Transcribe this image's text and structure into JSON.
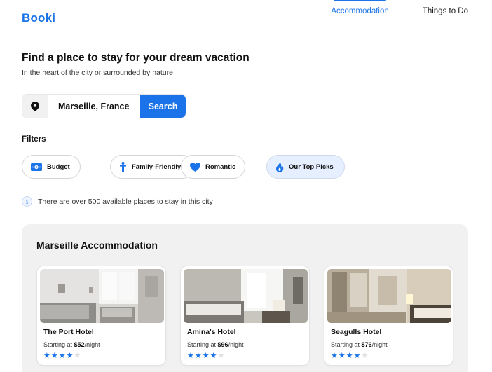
{
  "brand": {
    "logo": "Booki"
  },
  "nav": [
    {
      "label": "Accommodation",
      "active": true
    },
    {
      "label": "Things to Do",
      "active": false
    }
  ],
  "hero": {
    "title": "Find a place to stay for your dream vacation",
    "subtitle": "In the heart of the city or surrounded by nature"
  },
  "search": {
    "value": "Marseille, France",
    "placeholder": "Marseille, France",
    "button_label": "Search",
    "icon": "location-pin-icon"
  },
  "filters": {
    "title": "Filters",
    "items": [
      {
        "label": "Budget",
        "icon": "money-icon",
        "selected": false
      },
      {
        "label": "Family-Friendly",
        "icon": "person-icon",
        "selected": false
      },
      {
        "label": "Romantic",
        "icon": "heart-icon",
        "selected": false
      },
      {
        "label": "Our Top Picks",
        "icon": "fire-icon",
        "selected": true
      }
    ]
  },
  "info": {
    "text": "There are over 500 available places to stay in this city",
    "icon": "info-icon"
  },
  "accommodation": {
    "title": "Marseille Accommodation",
    "currency": "$",
    "price_prefix": "Starting at ",
    "price_suffix": "/night",
    "hotels": [
      {
        "name": "The Port Hotel",
        "price": "52",
        "rating": 4,
        "max_rating": 5
      },
      {
        "name": "Amina's Hotel",
        "price": "96",
        "rating": 4,
        "max_rating": 5
      },
      {
        "name": "Seagulls Hotel",
        "price": "76",
        "rating": 4,
        "max_rating": 5
      }
    ]
  },
  "colors": {
    "accent": "#1a73e8",
    "selected_chip_bg": "#e6efff",
    "panel_bg": "#f1f1f1",
    "star_empty": "#e0e0e0"
  }
}
